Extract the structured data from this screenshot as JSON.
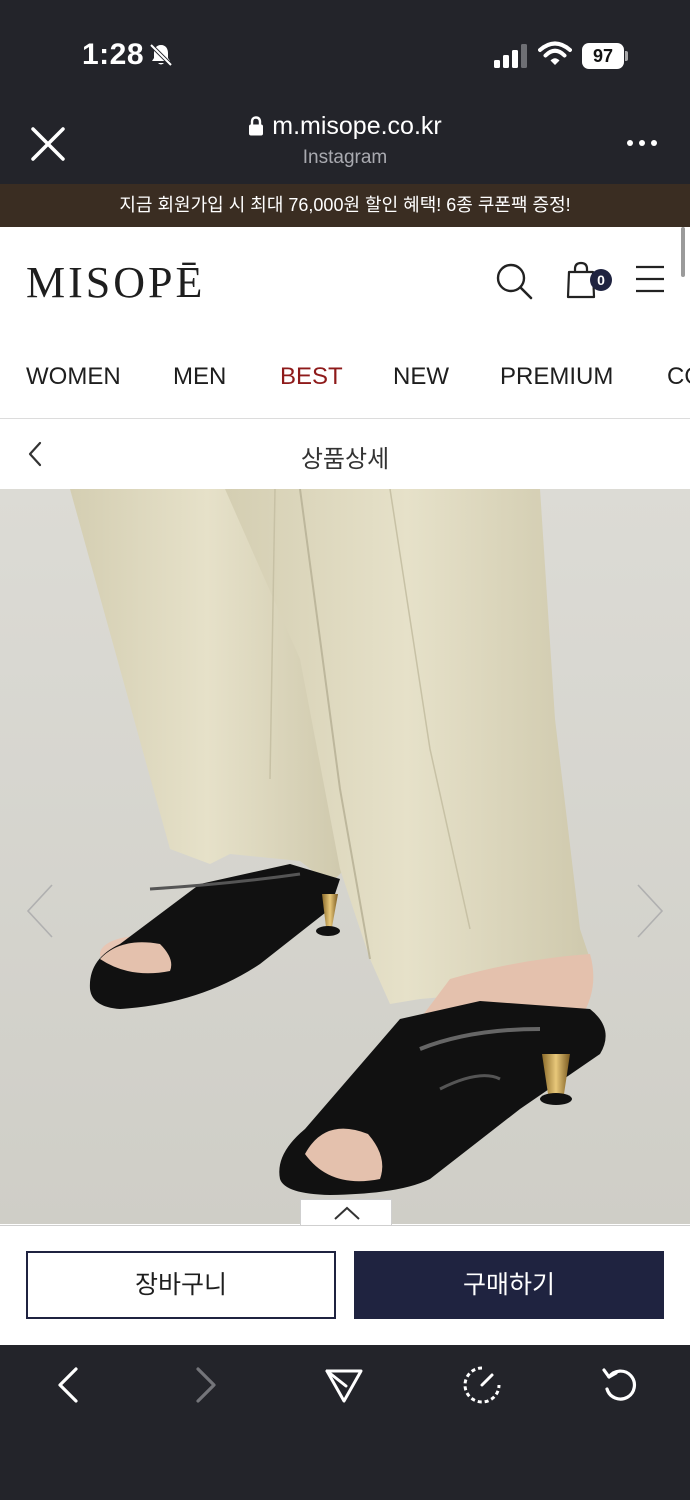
{
  "status_bar": {
    "time": "1:28",
    "battery_level": "97",
    "icons": [
      "bell-slash-icon",
      "cellular-signal-icon",
      "wifi-icon",
      "battery-icon"
    ]
  },
  "browser": {
    "url": "m.misope.co.kr",
    "source": "Instagram",
    "icons": [
      "close-icon",
      "lock-icon",
      "more-icon"
    ]
  },
  "promo": {
    "text": "지금 회원가입 시 최대 76,000원 할인 혜택! 6종 쿠폰팩 증정!",
    "background": "#3a2d22"
  },
  "header": {
    "logo": "MISOPĒ",
    "cart_count": "0",
    "icons": [
      "search-icon",
      "shopping-bag-icon",
      "hamburger-menu-icon"
    ]
  },
  "nav": {
    "items": [
      {
        "label": "WOMEN"
      },
      {
        "label": "MEN"
      },
      {
        "label": "BEST",
        "highlight": "#8e1a1a"
      },
      {
        "label": "NEW"
      },
      {
        "label": "PREMIUM"
      },
      {
        "label": "CO"
      }
    ]
  },
  "subheader": {
    "title": "상품상세"
  },
  "gallery": {
    "icons": [
      "chevron-left-icon",
      "chevron-right-icon",
      "chevron-up-icon"
    ]
  },
  "purchase": {
    "cart_label": "장바구니",
    "buy_label": "구매하기",
    "accent": "#1f2340"
  },
  "toolbar": {
    "icons": [
      "back-icon",
      "forward-icon",
      "share-icon",
      "safari-icon",
      "reload-icon"
    ]
  }
}
